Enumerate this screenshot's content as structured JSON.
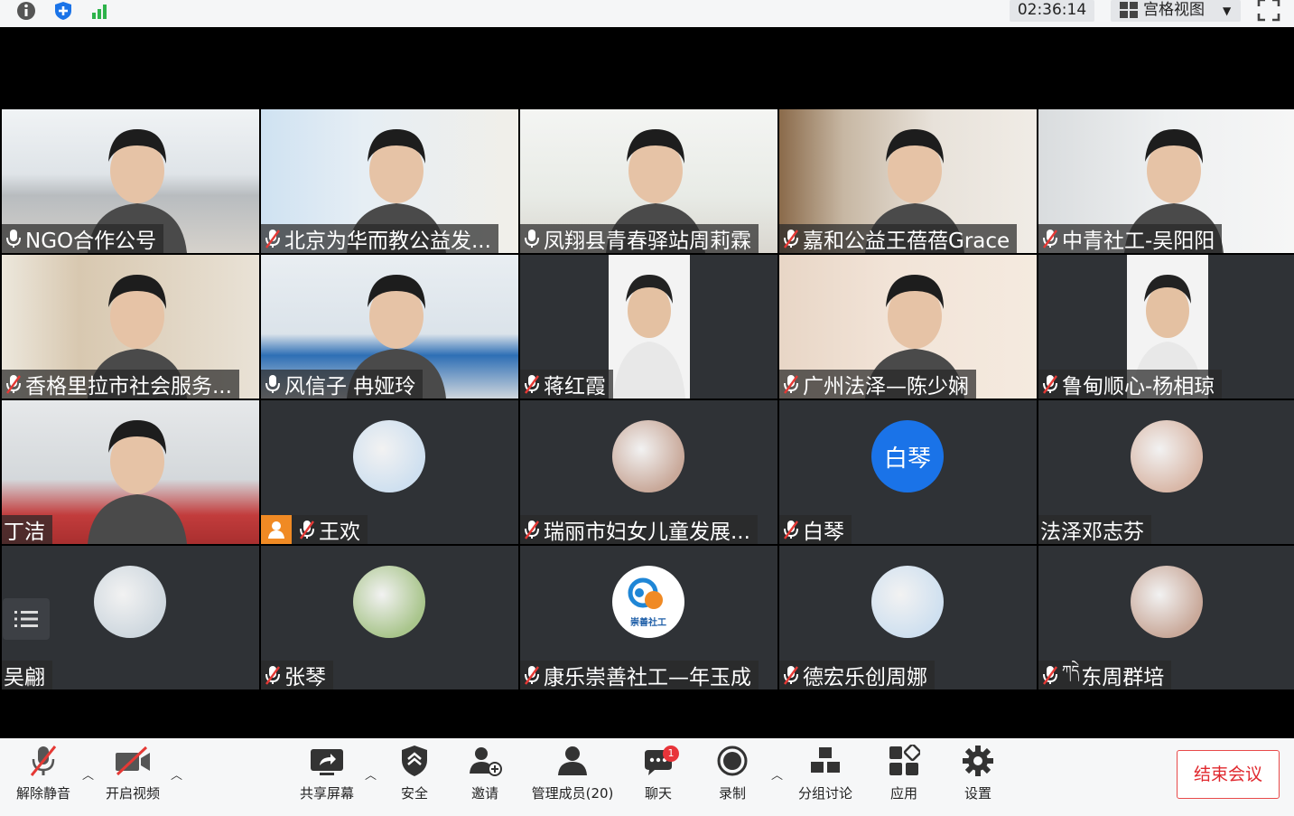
{
  "topbar": {
    "timer": "02:36:14",
    "view_label": "宫格视图",
    "icons": [
      "info-icon",
      "shield-icon",
      "signal-icon",
      "grid-icon",
      "fullscreen-icon"
    ]
  },
  "tiles": [
    {
      "name": "NGO合作公号",
      "mic": "on"
    },
    {
      "name": "北京为华而教公益发...",
      "mic": "muted"
    },
    {
      "name": "凤翔县青春驿站周莉霖",
      "mic": "on"
    },
    {
      "name": "嘉和公益王蓓蓓Grace",
      "mic": "muted"
    },
    {
      "name": "中青社工-吴阳阳",
      "mic": "muted"
    },
    {
      "name": "香格里拉市社会服务...",
      "mic": "muted"
    },
    {
      "name": "风信子 冉娅玲",
      "mic": "on"
    },
    {
      "name": "蒋红霞",
      "mic": "muted"
    },
    {
      "name": "广州法泽—陈少娴",
      "mic": "muted"
    },
    {
      "name": "鲁甸顺心-杨相琼",
      "mic": "muted"
    },
    {
      "name": "丁洁",
      "mic": "none"
    },
    {
      "name": "王欢",
      "mic": "muted"
    },
    {
      "name": "瑞丽市妇女儿童发展...",
      "mic": "muted"
    },
    {
      "name": "白琴",
      "mic": "muted",
      "avatar_text": "白琴"
    },
    {
      "name": "法泽邓志芬",
      "mic": "none"
    },
    {
      "name": "吴翩",
      "mic": "none"
    },
    {
      "name": "张琴",
      "mic": "muted"
    },
    {
      "name": "康乐崇善社工—年玉成",
      "mic": "muted",
      "logo_text": "崇善社工"
    },
    {
      "name": "德宏乐创周娜",
      "mic": "muted"
    },
    {
      "name": "东周群培",
      "mic": "muted",
      "prefix": "ཀདེ"
    }
  ],
  "toolbar": {
    "unmute": "解除静音",
    "start_video": "开启视频",
    "share_screen": "共享屏幕",
    "security": "安全",
    "invite": "邀请",
    "manage_members": "管理成员(20)",
    "chat": "聊天",
    "chat_badge": "1",
    "record": "录制",
    "breakout": "分组讨论",
    "apps": "应用",
    "settings": "设置",
    "end_meeting": "结束会议"
  },
  "colors": {
    "active_border": "#2ec56b",
    "end_button": "#e0282e",
    "avatar_blue": "#1a73e8",
    "badge_red": "#e8343a"
  }
}
